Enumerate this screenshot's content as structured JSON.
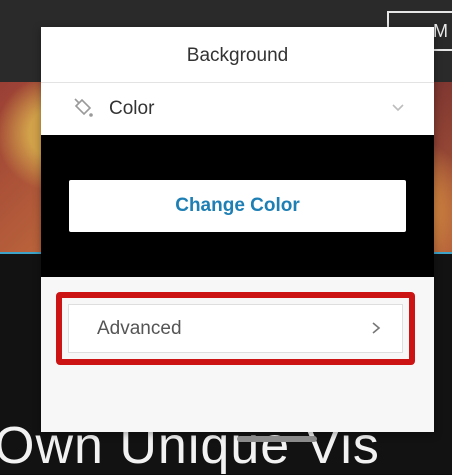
{
  "page": {
    "top_button_label": "M",
    "headline": "Own Unique Vis"
  },
  "panel": {
    "title": "Background",
    "type_selector": {
      "icon": "paint-bucket-icon",
      "value": "Color"
    },
    "change_color_label": "Change Color",
    "advanced_label": "Advanced"
  },
  "colors": {
    "accent_text": "#1d7fb4",
    "highlight_border": "#cc1414",
    "preview_background": "#000000"
  }
}
